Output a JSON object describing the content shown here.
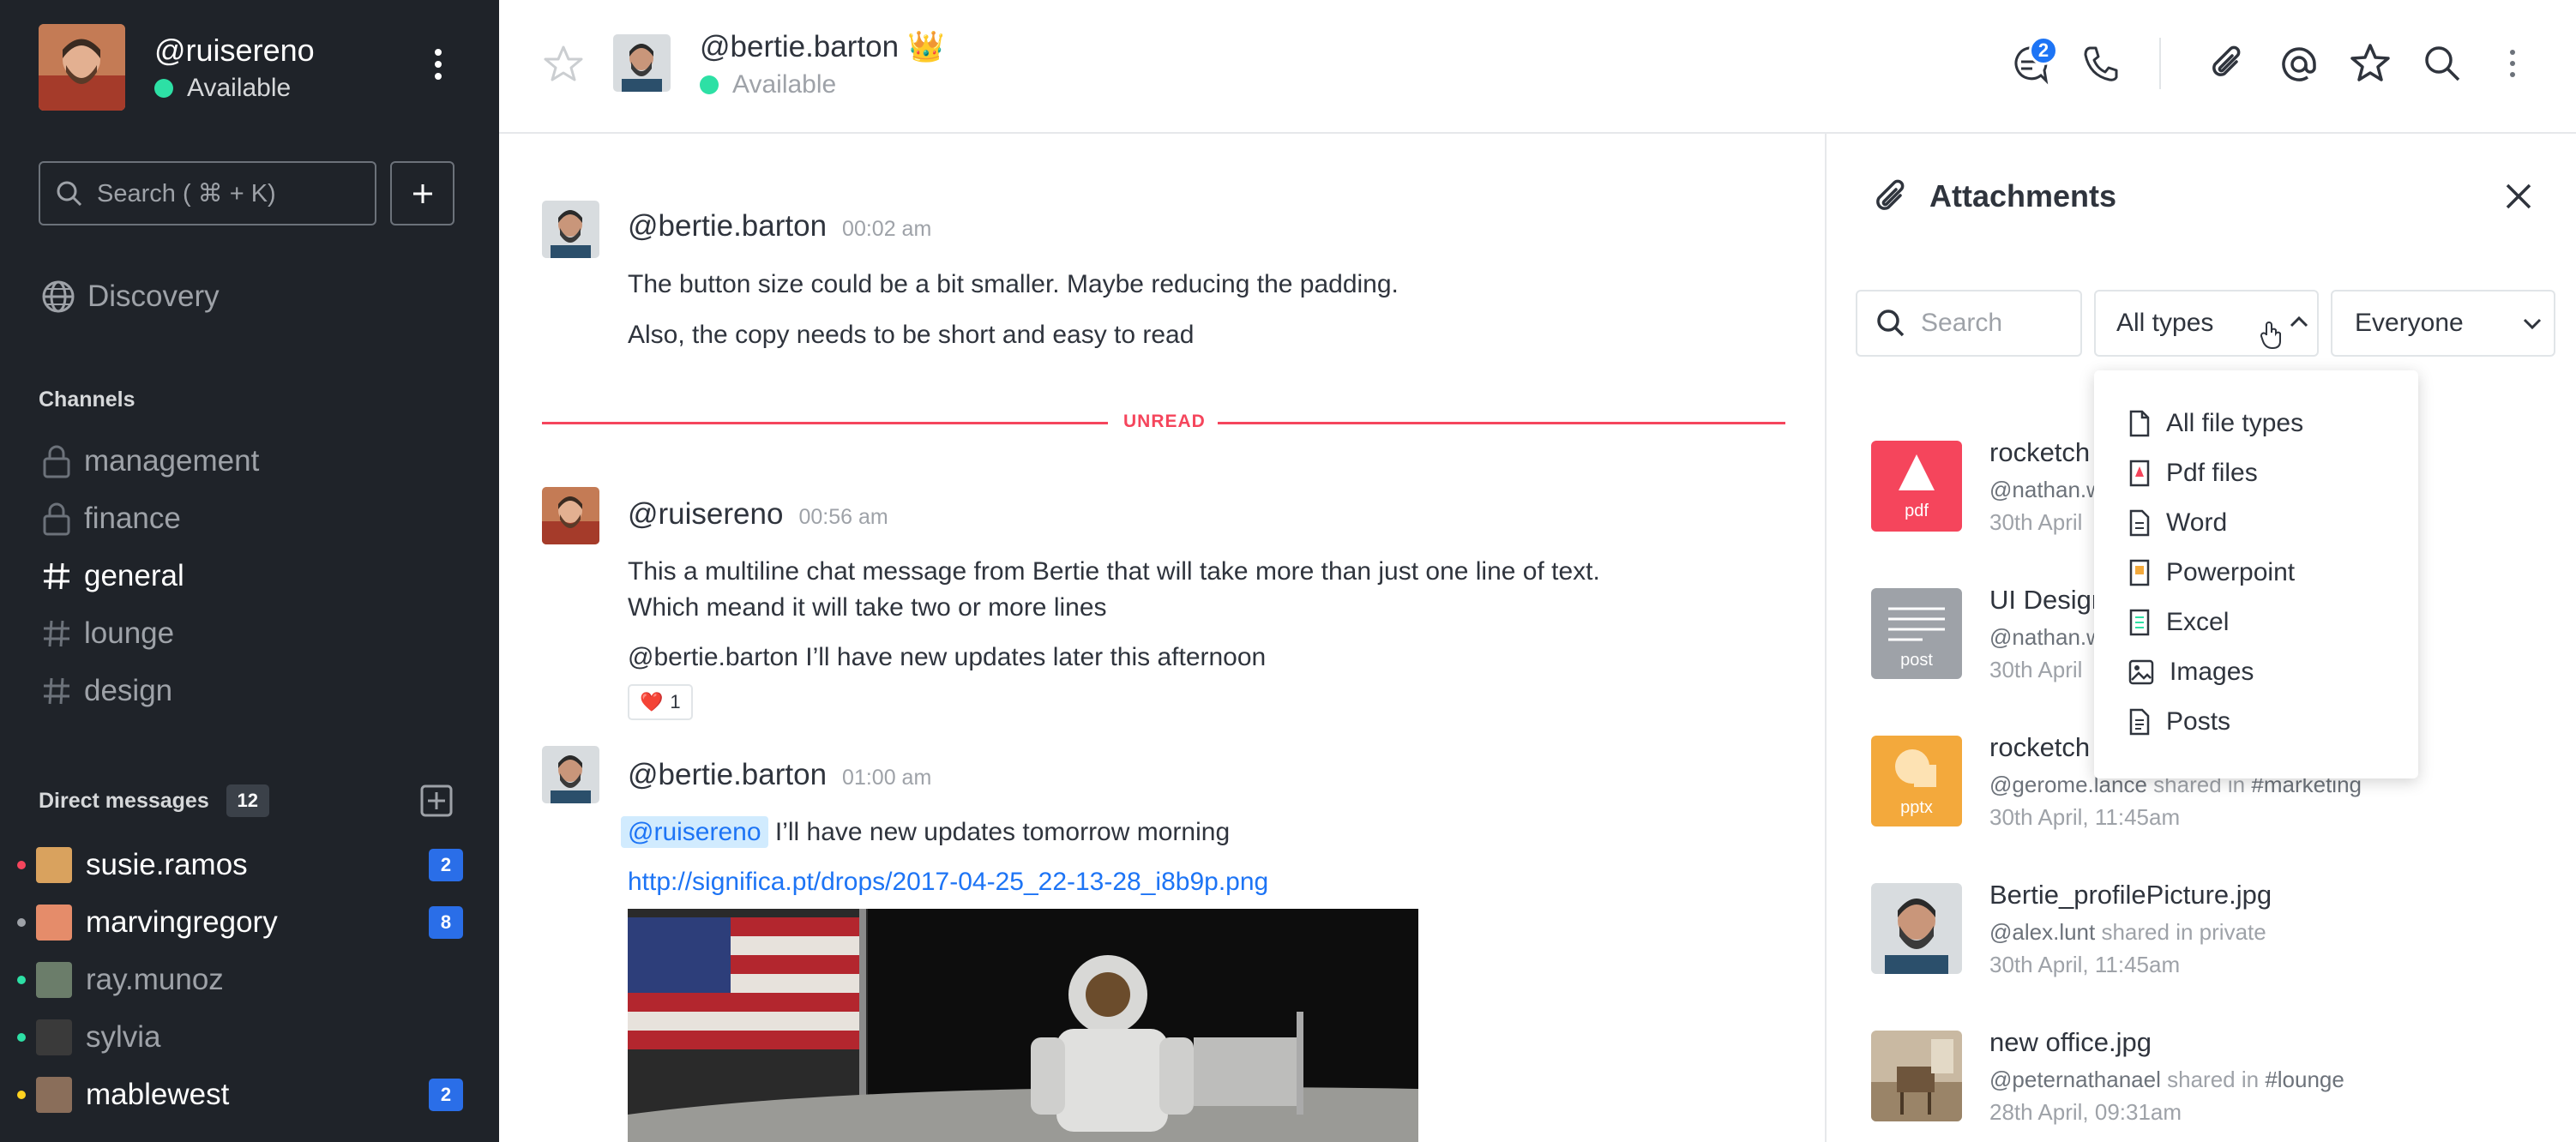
{
  "user": {
    "name": "@ruisereno",
    "status": "Available"
  },
  "sidebar": {
    "search_placeholder": "Search ( ⌘ + K)",
    "discovery_label": "Discovery",
    "channels_heading": "Channels",
    "channels": [
      {
        "name": "management",
        "type": "private"
      },
      {
        "name": "finance",
        "type": "private"
      },
      {
        "name": "general",
        "type": "public",
        "active": true
      },
      {
        "name": "lounge",
        "type": "public"
      },
      {
        "name": "design",
        "type": "public"
      }
    ],
    "dm_heading": "Direct messages",
    "dm_count": "12",
    "direct_messages": [
      {
        "name": "susie.ramos",
        "badge": "2",
        "dot_color": "#f5455c",
        "unread": true
      },
      {
        "name": "marvingregory",
        "badge": "8",
        "dot_color": "#9ea2a8",
        "unread": true
      },
      {
        "name": "ray.munoz",
        "badge": "",
        "dot_color": "#2de0a5",
        "unread": false
      },
      {
        "name": "sylvia",
        "badge": "",
        "dot_color": "#2de0a5",
        "unread": false
      },
      {
        "name": "mablewest",
        "badge": "2",
        "dot_color": "#ffd21f",
        "unread": true
      }
    ]
  },
  "header": {
    "room_name": "@bertie.barton",
    "room_status": "Available",
    "crown_icon": "👑",
    "threads_badge": "2"
  },
  "messages": [
    {
      "author": "@bertie.barton",
      "time": "00:02 am",
      "lines": [
        "The button size could be a bit smaller. Maybe reducing the padding.",
        "Also, the copy needs to be short and easy to read"
      ]
    },
    {
      "author": "@ruisereno",
      "time": "00:56 am",
      "line1": "This a multiline chat message from Bertie that will take more than just one line of text.",
      "line2": "Which meand it will take two or more lines",
      "mention_author": "@bertie.barton",
      "mention_text": " I’ll have new updates later this afternoon",
      "reaction_emoji": "❤️",
      "reaction_count": "1"
    },
    {
      "author": "@bertie.barton",
      "time": "01:00 am",
      "mention": "@ruisereno",
      "text": " I’ll have new updates tomorrow morning",
      "link": "http://significa.pt/drops/2017-04-25_22-13-28_i8b9p.png"
    }
  ],
  "unread_label": "UNREAD",
  "attachments": {
    "title": "Attachments",
    "search_placeholder": "Search",
    "type_filter": "All types",
    "user_filter": "Everyone",
    "type_options": [
      "All file types",
      "Pdf files",
      "Word",
      "Powerpoint",
      "Excel",
      "Images",
      "Posts"
    ],
    "items": [
      {
        "name": "rocketch",
        "author": "@nathan.w",
        "shared_word": "",
        "location": "",
        "date": "30th April",
        "thumb": "pdf"
      },
      {
        "name": "UI Design",
        "author": "@nathan.w",
        "shared_word": "",
        "location": "",
        "date": "30th April",
        "thumb": "post"
      },
      {
        "name": "rocketch",
        "author": "@gerome.lance",
        "shared_word": "shared in",
        "location": "#marketing",
        "date": "30th April, 11:45am",
        "thumb": "pptx"
      },
      {
        "name": "Bertie_profilePicture.jpg",
        "author": "@alex.lunt",
        "shared_word": "shared in",
        "location": "private",
        "date": "30th April, 11:45am",
        "thumb": "image"
      },
      {
        "name": "new office.jpg",
        "author": "@peternathanael",
        "shared_word": "shared in",
        "location": "#lounge",
        "date": "28th April, 09:31am",
        "thumb": "image"
      }
    ]
  },
  "colors": {
    "sidebar_bg": "#1f2329",
    "accent": "#1d74f5",
    "unread": "#f5455c",
    "online": "#2de0a5"
  }
}
